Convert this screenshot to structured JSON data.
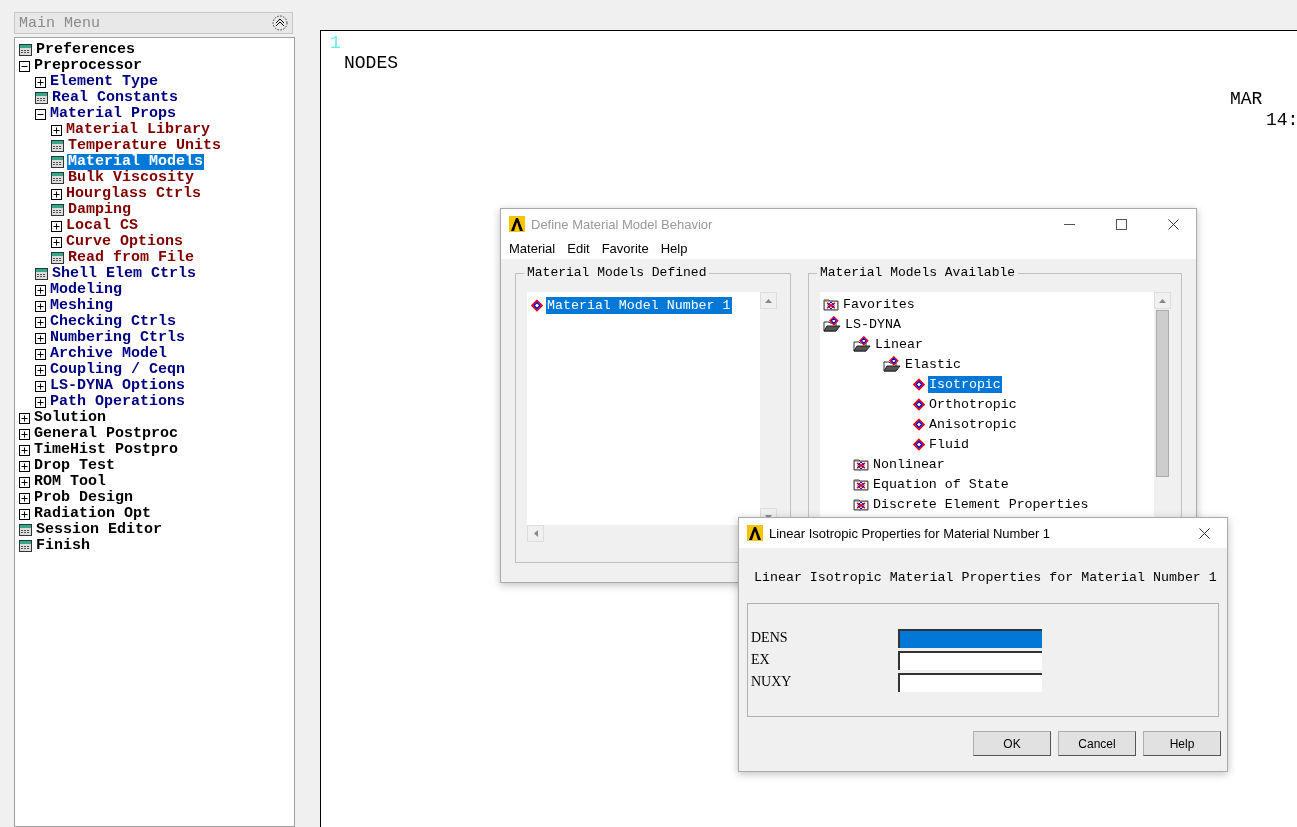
{
  "main_menu": {
    "title": "Main Menu",
    "items": [
      {
        "label": "Preferences",
        "kind": "action",
        "selected": false
      },
      {
        "label": "Preprocessor",
        "kind": "branch",
        "expanded": true,
        "selected": false,
        "children": [
          {
            "label": "Element Type",
            "kind": "branch",
            "expanded": false,
            "selected": false
          },
          {
            "label": "Real Constants",
            "kind": "action",
            "selected": false
          },
          {
            "label": "Material Props",
            "kind": "branch",
            "expanded": true,
            "selected": false,
            "children": [
              {
                "label": "Material Library",
                "kind": "branch",
                "expanded": false,
                "selected": false
              },
              {
                "label": "Temperature Units",
                "kind": "action",
                "selected": false
              },
              {
                "label": "Material Models",
                "kind": "action",
                "selected": true
              },
              {
                "label": "Bulk Viscosity",
                "kind": "action",
                "selected": false
              },
              {
                "label": "Hourglass Ctrls",
                "kind": "branch",
                "expanded": false,
                "selected": false
              },
              {
                "label": "Damping",
                "kind": "action",
                "selected": false
              },
              {
                "label": "Local CS",
                "kind": "branch",
                "expanded": false,
                "selected": false
              },
              {
                "label": "Curve Options",
                "kind": "branch",
                "expanded": false,
                "selected": false
              },
              {
                "label": "Read from File",
                "kind": "action",
                "selected": false
              }
            ]
          },
          {
            "label": "Shell Elem Ctrls",
            "kind": "action",
            "selected": false
          },
          {
            "label": "Modeling",
            "kind": "branch",
            "expanded": false,
            "selected": false
          },
          {
            "label": "Meshing",
            "kind": "branch",
            "expanded": false,
            "selected": false
          },
          {
            "label": "Checking Ctrls",
            "kind": "branch",
            "expanded": false,
            "selected": false
          },
          {
            "label": "Numbering Ctrls",
            "kind": "branch",
            "expanded": false,
            "selected": false
          },
          {
            "label": "Archive Model",
            "kind": "branch",
            "expanded": false,
            "selected": false
          },
          {
            "label": "Coupling / Ceqn",
            "kind": "branch",
            "expanded": false,
            "selected": false
          },
          {
            "label": "LS-DYNA Options",
            "kind": "branch",
            "expanded": false,
            "selected": false
          },
          {
            "label": "Path Operations",
            "kind": "branch",
            "expanded": false,
            "selected": false
          }
        ]
      },
      {
        "label": "Solution",
        "kind": "branch",
        "expanded": false,
        "selected": false
      },
      {
        "label": "General Postproc",
        "kind": "branch",
        "expanded": false,
        "selected": false
      },
      {
        "label": "TimeHist Postpro",
        "kind": "branch",
        "expanded": false,
        "selected": false
      },
      {
        "label": "Drop Test",
        "kind": "branch",
        "expanded": false,
        "selected": false
      },
      {
        "label": "ROM Tool",
        "kind": "branch",
        "expanded": false,
        "selected": false
      },
      {
        "label": "Prob Design",
        "kind": "branch",
        "expanded": false,
        "selected": false
      },
      {
        "label": "Radiation Opt",
        "kind": "branch",
        "expanded": false,
        "selected": false
      },
      {
        "label": "Session Editor",
        "kind": "action",
        "selected": false
      },
      {
        "label": "Finish",
        "kind": "action",
        "selected": false
      }
    ]
  },
  "graphics": {
    "window_number": "1",
    "label": "NODES",
    "date": "MAR",
    "time": "14:"
  },
  "material_dialog": {
    "title": "Define Material Model Behavior",
    "menu": [
      "Material",
      "Edit",
      "Favorite",
      "Help"
    ],
    "defined": {
      "title": "Material Models Defined",
      "items": [
        {
          "label": "Material Model Number 1",
          "selected": true
        }
      ]
    },
    "available": {
      "title": "Material Models Available",
      "items": [
        {
          "label": "Favorites",
          "kind": "folder",
          "selected": false
        },
        {
          "label": "LS-DYNA",
          "kind": "open-folder",
          "selected": false,
          "children": [
            {
              "label": "Linear",
              "kind": "open-folder",
              "selected": false,
              "children": [
                {
                  "label": "Elastic",
                  "kind": "open-folder",
                  "selected": false,
                  "children": [
                    {
                      "label": "Isotropic",
                      "kind": "model",
                      "selected": true
                    },
                    {
                      "label": "Orthotropic",
                      "kind": "model",
                      "selected": false
                    },
                    {
                      "label": "Anisotropic",
                      "kind": "model",
                      "selected": false
                    },
                    {
                      "label": "Fluid",
                      "kind": "model",
                      "selected": false
                    }
                  ]
                }
              ]
            },
            {
              "label": "Nonlinear",
              "kind": "folder",
              "selected": false
            },
            {
              "label": "Equation of State",
              "kind": "folder",
              "selected": false
            },
            {
              "label": "Discrete Element Properties",
              "kind": "folder",
              "selected": false
            }
          ]
        }
      ]
    }
  },
  "properties_dialog": {
    "title": "Linear Isotropic Properties for Material Number 1",
    "heading": "Linear Isotropic Material Properties for Material Number 1",
    "fields": [
      {
        "label": "DENS",
        "focused": true
      },
      {
        "label": "EX",
        "focused": false
      },
      {
        "label": "NUXY",
        "focused": false
      }
    ],
    "buttons": [
      "OK",
      "Cancel",
      "Help"
    ]
  }
}
